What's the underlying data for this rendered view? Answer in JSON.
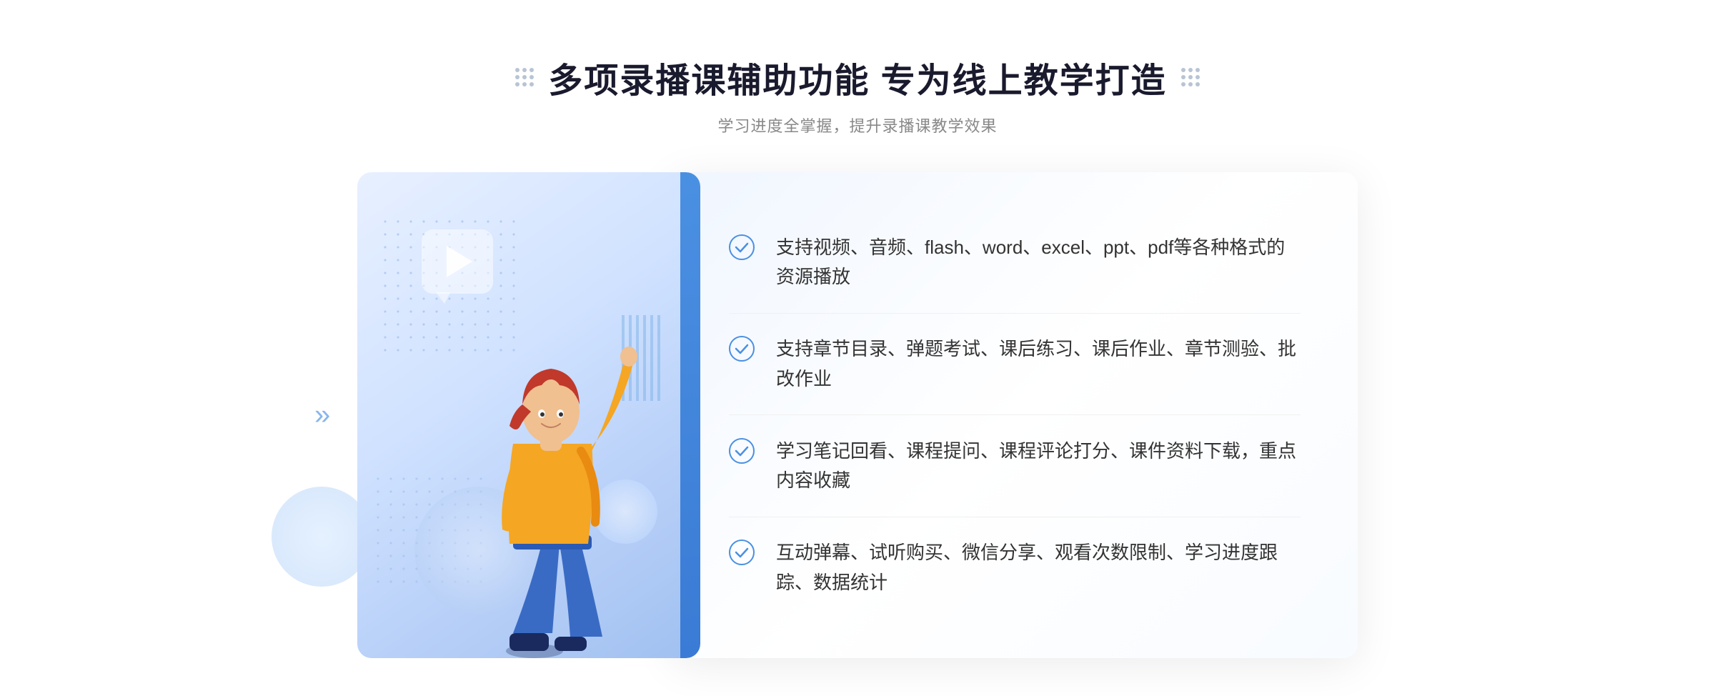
{
  "header": {
    "title": "多项录播课辅助功能 专为线上教学打造",
    "subtitle": "学习进度全掌握，提升录播课教学效果"
  },
  "features": [
    {
      "id": "feature-1",
      "text": "支持视频、音频、flash、word、excel、ppt、pdf等各种格式的资源播放"
    },
    {
      "id": "feature-2",
      "text": "支持章节目录、弹题考试、课后练习、课后作业、章节测验、批改作业"
    },
    {
      "id": "feature-3",
      "text": "学习笔记回看、课程提问、课程评论打分、课件资料下载，重点内容收藏"
    },
    {
      "id": "feature-4",
      "text": "互动弹幕、试听购买、微信分享、观看次数限制、学习进度跟踪、数据统计"
    }
  ],
  "colors": {
    "accent": "#4a90e2",
    "title": "#1a1a2e",
    "text": "#333333",
    "subtitle": "#888888",
    "check": "#4a90e2"
  }
}
